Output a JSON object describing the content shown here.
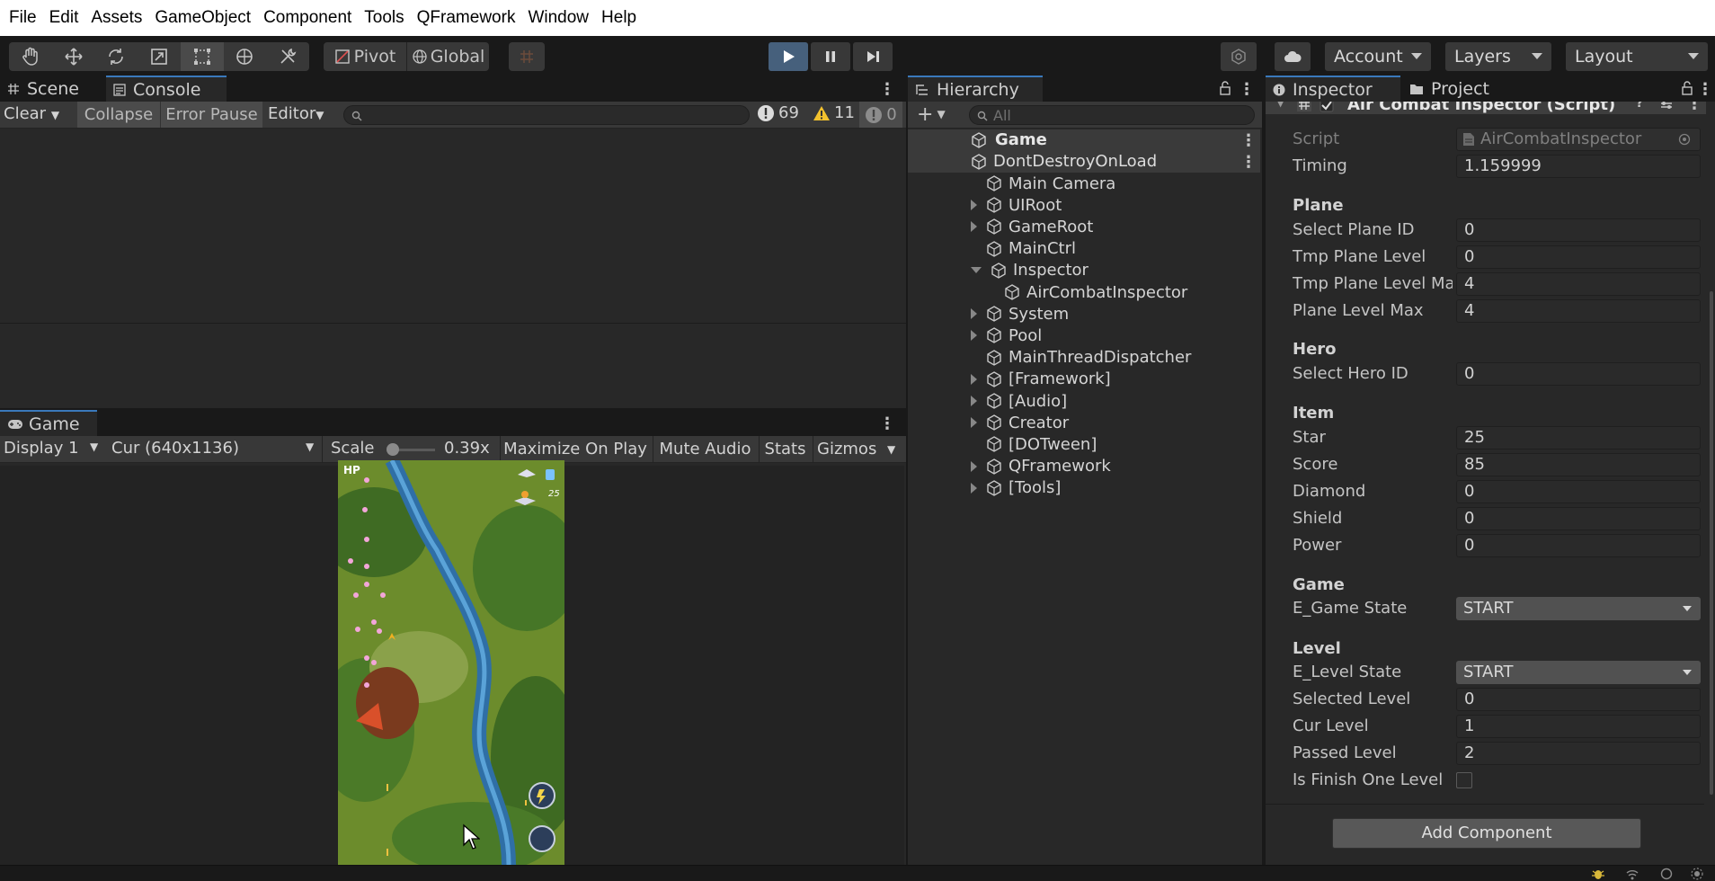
{
  "menu": [
    "File",
    "Edit",
    "Assets",
    "GameObject",
    "Component",
    "Tools",
    "QFramework",
    "Window",
    "Help"
  ],
  "toolbar": {
    "pivot_label": "Pivot",
    "global_label": "Global",
    "account_label": "Account",
    "layers_label": "Layers",
    "layout_label": "Layout"
  },
  "scene_tabs": {
    "scene": "Scene",
    "console": "Console"
  },
  "console": {
    "clear": "Clear",
    "collapse": "Collapse",
    "error_pause": "Error Pause",
    "editor": "Editor",
    "log_count": "69",
    "warn_count": "11",
    "error_count": "0"
  },
  "game": {
    "tab": "Game",
    "display": "Display 1",
    "resolution": "Cur (640x1136)",
    "scale_label": "Scale",
    "scale_value": "0.39x",
    "maximize": "Maximize On Play",
    "mute": "Mute Audio",
    "stats": "Stats",
    "gizmos": "Gizmos",
    "hp_label": "HP",
    "hud_score": "25"
  },
  "hierarchy": {
    "title": "Hierarchy",
    "search_placeholder": "All",
    "scenes": [
      "Game",
      "DontDestroyOnLoad"
    ],
    "items": [
      {
        "label": "Main Camera",
        "expand": "none",
        "depth": 0
      },
      {
        "label": "UIRoot",
        "expand": "closed",
        "depth": 0
      },
      {
        "label": "GameRoot",
        "expand": "closed",
        "depth": 0
      },
      {
        "label": "MainCtrl",
        "expand": "none",
        "depth": 0
      },
      {
        "label": "Inspector",
        "expand": "open",
        "depth": 0
      },
      {
        "label": "AirCombatInspector",
        "expand": "none",
        "depth": 1
      },
      {
        "label": "System",
        "expand": "closed",
        "depth": 0
      },
      {
        "label": "Pool",
        "expand": "closed",
        "depth": 0
      },
      {
        "label": "MainThreadDispatcher",
        "expand": "none",
        "depth": 0
      },
      {
        "label": "[Framework]",
        "expand": "closed",
        "depth": 0
      },
      {
        "label": "[Audio]",
        "expand": "closed",
        "depth": 0
      },
      {
        "label": "Creator",
        "expand": "closed",
        "depth": 0
      },
      {
        "label": "[DOTween]",
        "expand": "none",
        "depth": 0
      },
      {
        "label": "QFramework",
        "expand": "closed",
        "depth": 0
      },
      {
        "label": "[Tools]",
        "expand": "closed",
        "depth": 0
      }
    ]
  },
  "inspector": {
    "tab_inspector": "Inspector",
    "tab_project": "Project",
    "component_title": "Air Combat Inspector (Script)",
    "script_label": "Script",
    "script_value": "AirCombatInspector",
    "timing_label": "Timing",
    "timing_value": "1.159999",
    "plane_header": "Plane",
    "select_plane_id_label": "Select Plane ID",
    "select_plane_id": "0",
    "tmp_plane_level_label": "Tmp Plane Level",
    "tmp_plane_level": "0",
    "tmp_plane_level_max_label": "Tmp Plane Level Ma",
    "tmp_plane_level_max": "4",
    "plane_level_max_label": "Plane Level Max",
    "plane_level_max": "4",
    "hero_header": "Hero",
    "select_hero_id_label": "Select Hero ID",
    "select_hero_id": "0",
    "item_header": "Item",
    "star_label": "Star",
    "star": "25",
    "score_label": "Score",
    "score": "85",
    "diamond_label": "Diamond",
    "diamond": "0",
    "shield_label": "Shield",
    "shield": "0",
    "power_label": "Power",
    "power": "0",
    "game_header": "Game",
    "game_state_label": "E_Game State",
    "game_state": "START",
    "level_header": "Level",
    "level_state_label": "E_Level State",
    "level_state": "START",
    "selected_level_label": "Selected Level",
    "selected_level": "0",
    "cur_level_label": "Cur Level",
    "cur_level": "1",
    "passed_level_label": "Passed Level",
    "passed_level": "2",
    "finish_one_label": "Is Finish One Level",
    "finish_one": false,
    "add_component": "Add Component"
  },
  "colors": {
    "accent": "#3a79bb",
    "play_active": "#46607c",
    "panel_bg": "#282828",
    "toolbar_bg": "#191919"
  }
}
